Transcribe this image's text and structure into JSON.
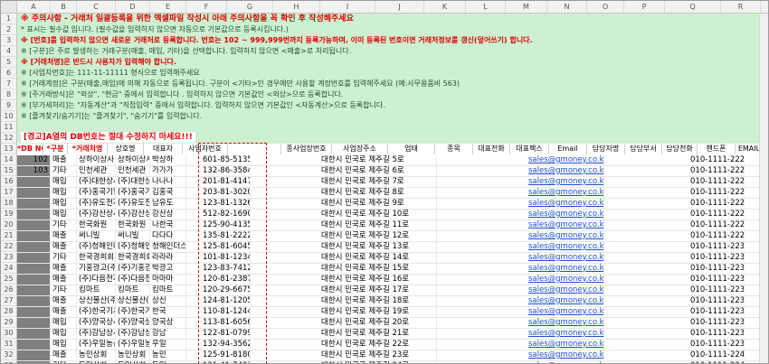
{
  "columns": [
    "A",
    "B",
    "C",
    "D",
    "E",
    "F",
    "G",
    "H",
    "I",
    "J",
    "K",
    "L",
    "M",
    "N",
    "O",
    "P",
    "Q",
    "R"
  ],
  "rows": [
    "1",
    "2",
    "3",
    "4",
    "5",
    "6",
    "7",
    "8",
    "9",
    "10",
    "11",
    "12",
    "13",
    "14",
    "15",
    "16",
    "17",
    "18",
    "19",
    "20",
    "21",
    "22",
    "23",
    "24",
    "25",
    "26",
    "27",
    "28",
    "29",
    "30",
    "31",
    "32",
    "33"
  ],
  "notes": [
    "※ 주의사항 - 거래처 일괄등록을 위한 엑셀파일 작성시 아래 주의사항을 꼭 확인 후 작성해주세요",
    "* 표시는 필수값 입니다. (필수값을 입력하지 않으면 자동으로 기본값으로 등록시킵니다.)",
    "※ [번호]를 입력하지 않으면 새로운 거래처로 등록합니다. 번호는 102 ~ 999,999번까지 등록가능하며, 이미 등록된 번호이면 거래처정보를 갱신(덮어쓰기) 합니다.",
    "※ [구분]은 주로 발생하는 거래구분(매출, 매입, 기타)을 선택합니다. 입력하지 않으면 <매출>로 처리됩니다.",
    "※ [거래처명]은 반드시 사용자가 입력해야 합니다.",
    "※ [사업자번호]는 111-11-11111 형식으로 입력해주세요",
    "※ [거래계정]은 구분(매출,매입)에 의해 자동으로 등록됩니다. 구분이 <기타>인 경우에만 사용할 계정번호를 입력해주세요 (예:사무용품비 563)",
    "※ [주거래방식]은 \"외상\", \"현금\" 중에서 입력합니다 . 입력하지 않으면 기본값인 <외상>으로 등록합니다.",
    "※ [부가세처리]는 \"자동계산\"과 \"직접입력\" 중에서 입력합니다. 입력하지 않으면 기본값인 <자동계산>으로 등록합니다.",
    "※ [즐겨찾기/숨기기]는 \"즐겨찾기\", \"숨기기\"를 입력합니다."
  ],
  "warning": "[경고]A열의 DB번호는 절대 수정하지 마세요!!!",
  "headers": [
    "*DB NO",
    "*구분",
    "*거래처명",
    "상호명",
    "대표자",
    "사업자번호",
    "",
    "종사업장번호",
    "사업장주소",
    "업태",
    "종목",
    "대표전화",
    "대표팩스",
    "Email",
    "담당자명",
    "담당부서",
    "담당전화",
    "핸드폰",
    "EMAIL2"
  ],
  "data_rows": [
    {
      "db": "102",
      "type": "매출",
      "name": "상하이상사",
      "corp": "상하이상사",
      "ceo": "박상하",
      "bizno": "601-85-51352",
      "addr": "대한시 민국로 제주길 5로",
      "email": "sales@gmoney.co.kr",
      "phone": "010-1111-2222"
    },
    {
      "db": "103",
      "type": "기타",
      "name": "인천세관",
      "corp": "인천세관",
      "ceo": "가가가",
      "bizno": "132-86-35848",
      "addr": "대한시 민국로 제주길 6로",
      "email": "sales@gmoney.co.kr",
      "phone": "010-1111-2223"
    },
    {
      "db": "",
      "type": "매입",
      "name": "(주)대한상사",
      "corp": "(주)대한상사",
      "ceo": "나나나",
      "bizno": "201-81-41471",
      "addr": "대한시 민국로 제주길 7로",
      "email": "sales@gmoney.co.kr",
      "phone": "010-1111-2224"
    },
    {
      "db": "",
      "type": "매입",
      "name": "(주)홍국기업",
      "corp": "(주)홍국기업",
      "ceo": "김홍국",
      "bizno": "203-81-30209",
      "addr": "대한시 민국로 제주길 8로",
      "email": "sales@gmoney.co.kr",
      "phone": "010-1111-2225"
    },
    {
      "db": "",
      "type": "매입",
      "name": "(주)유도전자",
      "corp": "(주)유도전자",
      "ceo": "남유도",
      "bizno": "123-81-13262",
      "addr": "대한시 민국로 제주길 9로",
      "email": "sales@gmoney.co.kr",
      "phone": "010-1111-2226"
    },
    {
      "db": "",
      "type": "매입",
      "name": "(주)강산상사",
      "corp": "(주)강산상사",
      "ceo": "강산상",
      "bizno": "512-82-16904",
      "addr": "대한시 민국로 제주길 10로",
      "email": "sales@gmoney.co.kr",
      "phone": "010-1111-2227"
    },
    {
      "db": "",
      "type": "기타",
      "name": "한국화원",
      "corp": "한국화원",
      "ceo": "나한국",
      "bizno": "125-90-41354",
      "addr": "대한시 민국로 제주길 11로",
      "email": "sales@gmoney.co.kr",
      "phone": "010-1111-2228"
    },
    {
      "db": "",
      "type": "매출",
      "name": "써니빌",
      "corp": "써니빌",
      "ceo": "다다다",
      "bizno": "135-81-22221",
      "addr": "대한시 민국로 제주길 12로",
      "email": "sales@gmoney.co.kr",
      "phone": "010-1111-2229"
    },
    {
      "db": "",
      "type": "매출",
      "name": "(주)청해인더스",
      "corp": "(주)청해인더스",
      "ceo": "청해인더스",
      "bizno": "125-81-60456",
      "addr": "대한시 민국로 제주길 13로",
      "email": "sales@gmoney.co.kr",
      "phone": "010-1111-2230"
    },
    {
      "db": "",
      "type": "기타",
      "name": "한국경희회사",
      "corp": "한국경희회사",
      "ceo": "라라라",
      "bizno": "101-81-12341",
      "addr": "대한시 민국로 제주길 14로",
      "email": "sales@gmoney.co.kr",
      "phone": "010-1111-2231"
    },
    {
      "db": "",
      "type": "매출",
      "name": "기홍광고(주)",
      "corp": "(주)기홍광고",
      "ceo": "박광고",
      "bizno": "123-83-74128",
      "addr": "대한시 민국로 제주길 15로",
      "email": "sales@gmoney.co.kr",
      "phone": "010-1111-2232"
    },
    {
      "db": "",
      "type": "매출",
      "name": "(주)다음전자",
      "corp": "(주)다음전자",
      "ceo": "마마마",
      "bizno": "120-81-23873",
      "addr": "대한시 민국로 제주길 16로",
      "email": "sales@gmoney.co.kr",
      "phone": "010-1111-2233"
    },
    {
      "db": "",
      "type": "기타",
      "name": "킹마트",
      "corp": "킹마트",
      "ceo": "킹마트",
      "bizno": "120-29-66758",
      "addr": "대한시 민국로 제주길 17로",
      "email": "sales@gmoney.co.kr",
      "phone": "010-1111-2234"
    },
    {
      "db": "",
      "type": "매출",
      "name": "상신물산(주)",
      "corp": "상신물산(주)",
      "ceo": "상신",
      "bizno": "124-81-12058",
      "addr": "대한시 민국로 제주길 18로",
      "email": "sales@gmoney.co.kr",
      "phone": "010-1111-2235"
    },
    {
      "db": "",
      "type": "매출",
      "name": "(주)한국기계",
      "corp": "(주)한국기계",
      "ceo": "한국",
      "bizno": "110-81-12442",
      "addr": "대한시 민국로 제주길 19로",
      "email": "sales@gmoney.co.kr",
      "phone": "010-1111-2236"
    },
    {
      "db": "",
      "type": "매입",
      "name": "(주)양국상사",
      "corp": "(주)양국상사",
      "ceo": "양국상",
      "bizno": "113-81-60564",
      "addr": "대한시 민국로 제주길 20로",
      "email": "sales@gmoney.co.kr",
      "phone": "010-1111-2237"
    },
    {
      "db": "",
      "type": "매입",
      "name": "(주)강남상사",
      "corp": "(주)강남상사",
      "ceo": "강남",
      "bizno": "122-81-07995",
      "addr": "대한시 민국로 제주길 21로",
      "email": "sales@gmoney.co.kr",
      "phone": "010-1111-2238"
    },
    {
      "db": "",
      "type": "매입",
      "name": "(주)우일농산",
      "corp": "(주)우일농산",
      "ceo": "우일",
      "bizno": "132-94-35620",
      "addr": "대한시 민국로 제주길 22로",
      "email": "sales@gmoney.co.kr",
      "phone": "010-1111-2239"
    },
    {
      "db": "",
      "type": "매출",
      "name": "농민상회",
      "corp": "농민상회",
      "ceo": "농민",
      "bizno": "125-91-81805",
      "addr": "대한시 민국로 제주길 23로",
      "email": "sales@gmoney.co.kr",
      "phone": "010-1111-2240"
    },
    {
      "db": "",
      "type": "기타",
      "name": "동일상회",
      "corp": "동일상회",
      "ceo": "동일",
      "bizno": "121-41-74234",
      "addr": "대한시 민국로 제주길 24로",
      "email": "sales@gmoney.co.kr",
      "phone": "010-1111-2241"
    }
  ]
}
